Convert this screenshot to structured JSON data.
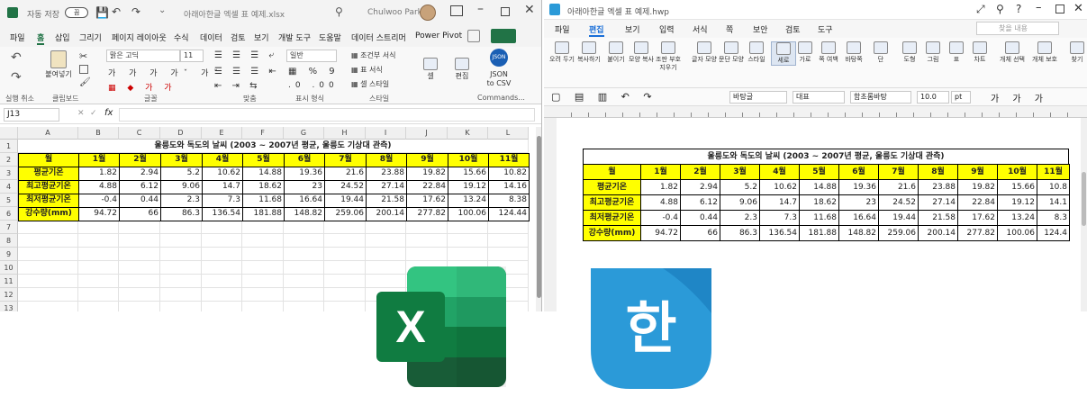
{
  "excel": {
    "autosave": "자동 저장",
    "autosave_state": "끔",
    "filename": "아래아한글 엑셀 표 예제.xlsx",
    "user": "Chulwoo Park",
    "menu": [
      "파일",
      "홈",
      "삽입",
      "그리기",
      "페이지 레이아웃",
      "수식",
      "데이터",
      "검토",
      "보기",
      "개발 도구",
      "도움말",
      "데이터 스트리머",
      "Power Pivot"
    ],
    "active_menu": "홈",
    "ribbon": {
      "undo_group": "실행 취소",
      "paste": "붙여넣기",
      "clipboard": "클립보드",
      "font_name": "맑은 고딕",
      "font_size": "11",
      "font_group": "글꼴",
      "align_group": "맞춤",
      "number_format": "일반",
      "number_group": "표시 형식",
      "cond_format": "조건부 서식",
      "table_format": "표 서식",
      "cell_style": "셀 스타일",
      "style_group": "스타일",
      "cells": "셀",
      "edit": "편집",
      "json_line1": "JSON",
      "json_line2": "to CSV",
      "commands": "Commands..."
    },
    "name_box": "J13",
    "formula": "",
    "columns": [
      "A",
      "B",
      "C",
      "D",
      "E",
      "F",
      "G",
      "H",
      "I",
      "J",
      "K",
      "L"
    ],
    "rows": [
      "1",
      "2",
      "3",
      "4",
      "5",
      "6",
      "7",
      "8",
      "9",
      "10",
      "11",
      "12",
      "13"
    ],
    "fx": "fx"
  },
  "hwp": {
    "filename": "아래아한글 엑셀 표 예제.hwp",
    "menu": [
      "파일",
      "편집",
      "보기",
      "입력",
      "서식",
      "쪽",
      "보안",
      "검토",
      "도구"
    ],
    "active_menu": "편집",
    "search_placeholder": "찾을 내용",
    "ribbon": [
      "오려 두기",
      "복사하기",
      "붙이기",
      "모양 복사",
      "조판 부호 지우기",
      "글자 모양",
      "문단 모양",
      "스타일",
      "세로",
      "가로",
      "쪽 여백",
      "바탕쪽",
      "단",
      "도형",
      "그림",
      "표",
      "차트",
      "개체 선택",
      "개체 보호",
      "찾기"
    ],
    "style_box": "바탕글",
    "lang_box": "대표",
    "font_box": "함초롬바탕",
    "size_box": "10.0",
    "size_unit": "pt"
  },
  "table": {
    "title": "울릉도와 독도의 날씨 (2003 ~ 2007년 평균, 울릉도 기상대 관측)",
    "header": [
      "월",
      "1월",
      "2월",
      "3월",
      "4월",
      "5월",
      "6월",
      "7월",
      "8월",
      "9월",
      "10월",
      "11월"
    ],
    "rows": [
      {
        "label": "평균기온",
        "values": [
          "1.82",
          "2.94",
          "5.2",
          "10.62",
          "14.88",
          "19.36",
          "21.6",
          "23.88",
          "19.82",
          "15.66",
          "10.82"
        ]
      },
      {
        "label": "최고평균기온",
        "values": [
          "4.88",
          "6.12",
          "9.06",
          "14.7",
          "18.62",
          "23",
          "24.52",
          "27.14",
          "22.84",
          "19.12",
          "14.16"
        ]
      },
      {
        "label": "최저평균기온",
        "values": [
          "-0.4",
          "0.44",
          "2.3",
          "7.3",
          "11.68",
          "16.64",
          "19.44",
          "21.58",
          "17.62",
          "13.24",
          "8.38"
        ]
      },
      {
        "label": "강수량(mm)",
        "values": [
          "94.72",
          "66",
          "86.3",
          "136.54",
          "181.88",
          "148.82",
          "259.06",
          "200.14",
          "277.82",
          "100.06",
          "124.44"
        ]
      }
    ],
    "hwp_header_last": "11월",
    "hwp_last_values": [
      "10.8",
      "14.1",
      "8.3",
      "124.4"
    ]
  },
  "logos": {
    "excel_letter": "X",
    "hwp_letter": "한",
    "excel_color": "#1d6f42",
    "hwp_color": "#2b9ad8"
  },
  "colors": {
    "header_yellow": "#ffff00",
    "excel_green": "#217346"
  }
}
